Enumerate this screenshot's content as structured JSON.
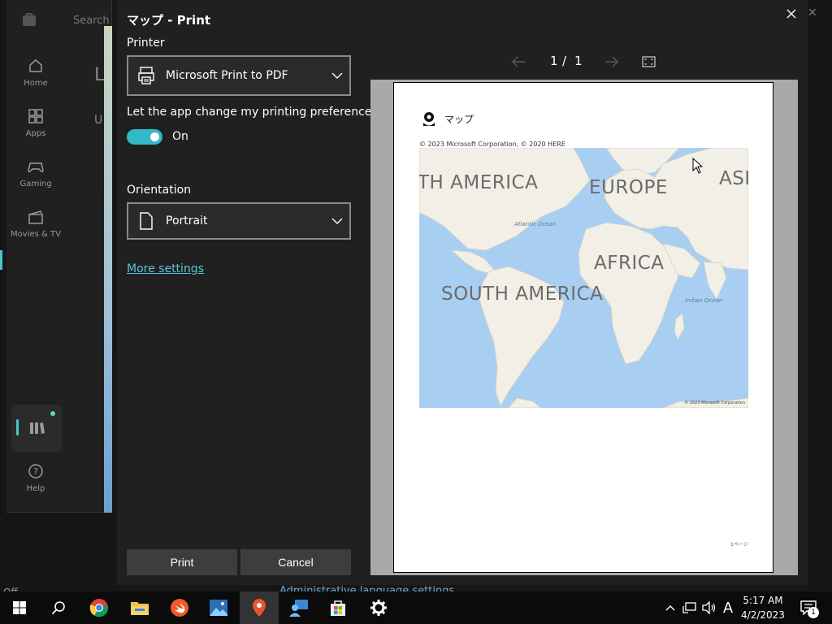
{
  "background_app": {
    "search_placeholder": "Search",
    "nav": [
      {
        "label": "Home"
      },
      {
        "label": "Apps"
      },
      {
        "label": "Gaming"
      },
      {
        "label": "Movies & TV"
      }
    ],
    "help_label": "Help",
    "peek_title": "L",
    "peek_sub": "U",
    "under_text": "Administrative language settings",
    "under_text_left": "Off"
  },
  "dialog": {
    "title": "マップ - Print",
    "printer_label": "Printer",
    "printer_value": "Microsoft Print to PDF",
    "prefs_label": "Let the app change my printing preferences",
    "toggle_state": "On",
    "orientation_label": "Orientation",
    "orientation_value": "Portrait",
    "more_settings": "More settings",
    "print_button": "Print",
    "cancel_button": "Cancel",
    "page_current": "1",
    "page_sep": "/",
    "page_total": "1"
  },
  "preview": {
    "app_name": "マップ",
    "copyright": "© 2023 Microsoft Corporation, © 2020 HERE",
    "map_labels": {
      "north_america": "TH AMERICA",
      "europe": "EUROPE",
      "asia": "ASI",
      "africa": "AFRICA",
      "south_america": "SOUTH AMERICA",
      "atlantic": "Atlantic Ocean",
      "indian": "Indian Ocean"
    },
    "map_copyright": "© 2023 Microsoft Corporation",
    "page_number": "1ページ"
  },
  "taskbar": {
    "time": "5:17 AM",
    "date": "4/2/2023",
    "ime": "A",
    "notification_count": "1"
  },
  "colors": {
    "accent": "#34b7c8",
    "link": "#56c7d6",
    "dialog_bg": "#202020",
    "map_water": "#a8cff2",
    "map_land": "#f1efe6"
  }
}
